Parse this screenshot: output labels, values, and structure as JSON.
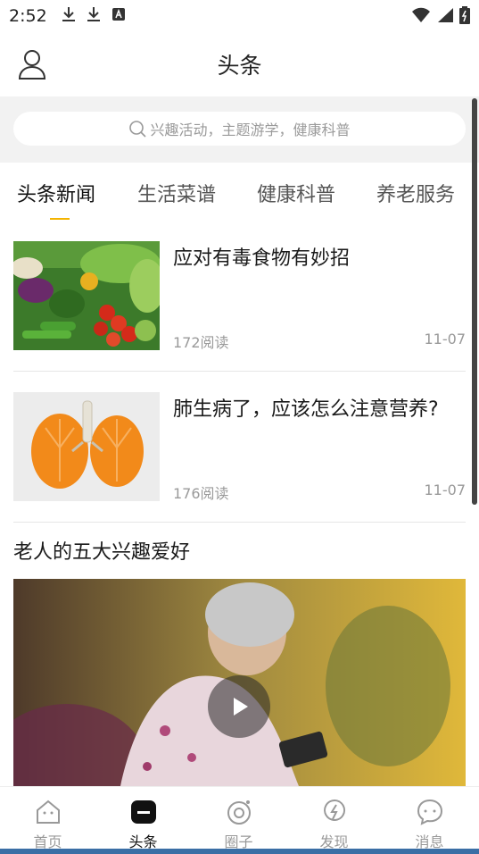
{
  "status_bar": {
    "time": "2:52"
  },
  "header": {
    "title": "头条"
  },
  "search": {
    "placeholder": "兴趣活动，主题游学，健康科普"
  },
  "tabs": [
    {
      "label": "头条新闻",
      "active": true
    },
    {
      "label": "生活菜谱",
      "active": false
    },
    {
      "label": "健康科普",
      "active": false
    },
    {
      "label": "养老服务",
      "active": false
    }
  ],
  "articles": [
    {
      "title": "应对有毒食物有妙招",
      "reads": "172阅读",
      "date": "11-07"
    },
    {
      "title": "肺生病了，应该怎么注意营养?",
      "reads": "176阅读",
      "date": "11-07"
    }
  ],
  "video": {
    "title": "老人的五大兴趣爱好"
  },
  "bottom_nav": [
    {
      "label": "首页",
      "icon": "home-icon",
      "active": false
    },
    {
      "label": "头条",
      "icon": "headline-icon",
      "active": true
    },
    {
      "label": "圈子",
      "icon": "circle-icon",
      "active": false
    },
    {
      "label": "发现",
      "icon": "discover-icon",
      "active": false
    },
    {
      "label": "消息",
      "icon": "message-icon",
      "active": false
    }
  ],
  "colors": {
    "accent": "#f4b400",
    "background": "#ffffff",
    "search_area": "#f2f2f2"
  }
}
